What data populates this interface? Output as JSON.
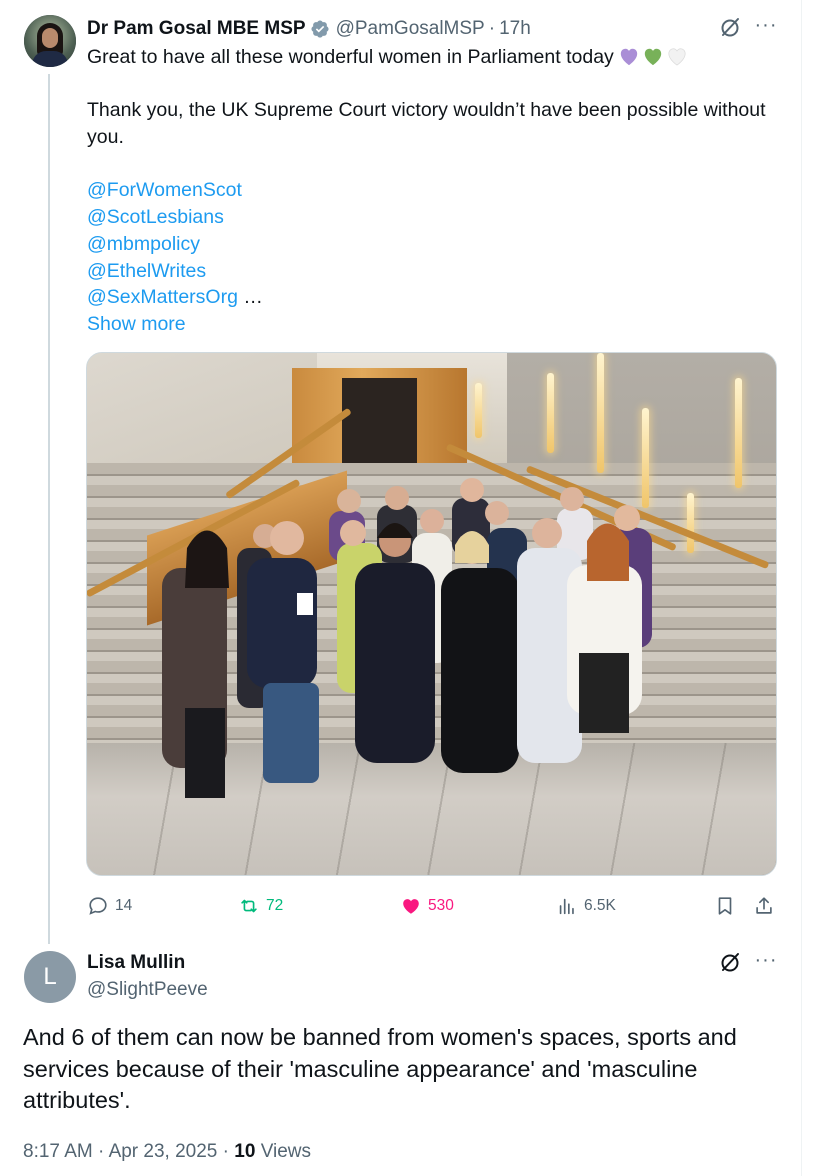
{
  "parent_tweet": {
    "author_name": "Dr Pam Gosal MBE MSP",
    "handle": "@PamGosalMSP",
    "separator": "·",
    "time_ago": "17h",
    "text_line1": "Great to have all these wonderful women in Parliament today",
    "heart_emojis": [
      "purple-heart",
      "green-heart",
      "white-heart"
    ],
    "text_paragraph2": "Thank you, the UK Supreme Court victory wouldn’t have been possible without you.",
    "mentions": [
      "@ForWomenScot",
      "@ScotLesbians",
      "@mbmpolicy",
      "@EthelWrites",
      "@SexMattersOrg"
    ],
    "ellipsis": " …",
    "show_more": "Show more",
    "actions": {
      "replies": "14",
      "reposts": "72",
      "likes": "530",
      "views": "6.5K"
    },
    "colors": {
      "repost": "#00ba7c",
      "like": "#f91880",
      "link": "#1d9bf0"
    }
  },
  "reply_tweet": {
    "avatar_letter": "L",
    "author_name": "Lisa Mullin",
    "handle": "@SlightPeeve",
    "text": "And 6 of them can now be banned from women's spaces, sports and services because of their 'masculine appearance' and 'masculine attributes'.",
    "time": "8:17 AM",
    "separator": "·",
    "date": "Apr 23, 2025",
    "views_count": "10",
    "views_label": "Views"
  }
}
